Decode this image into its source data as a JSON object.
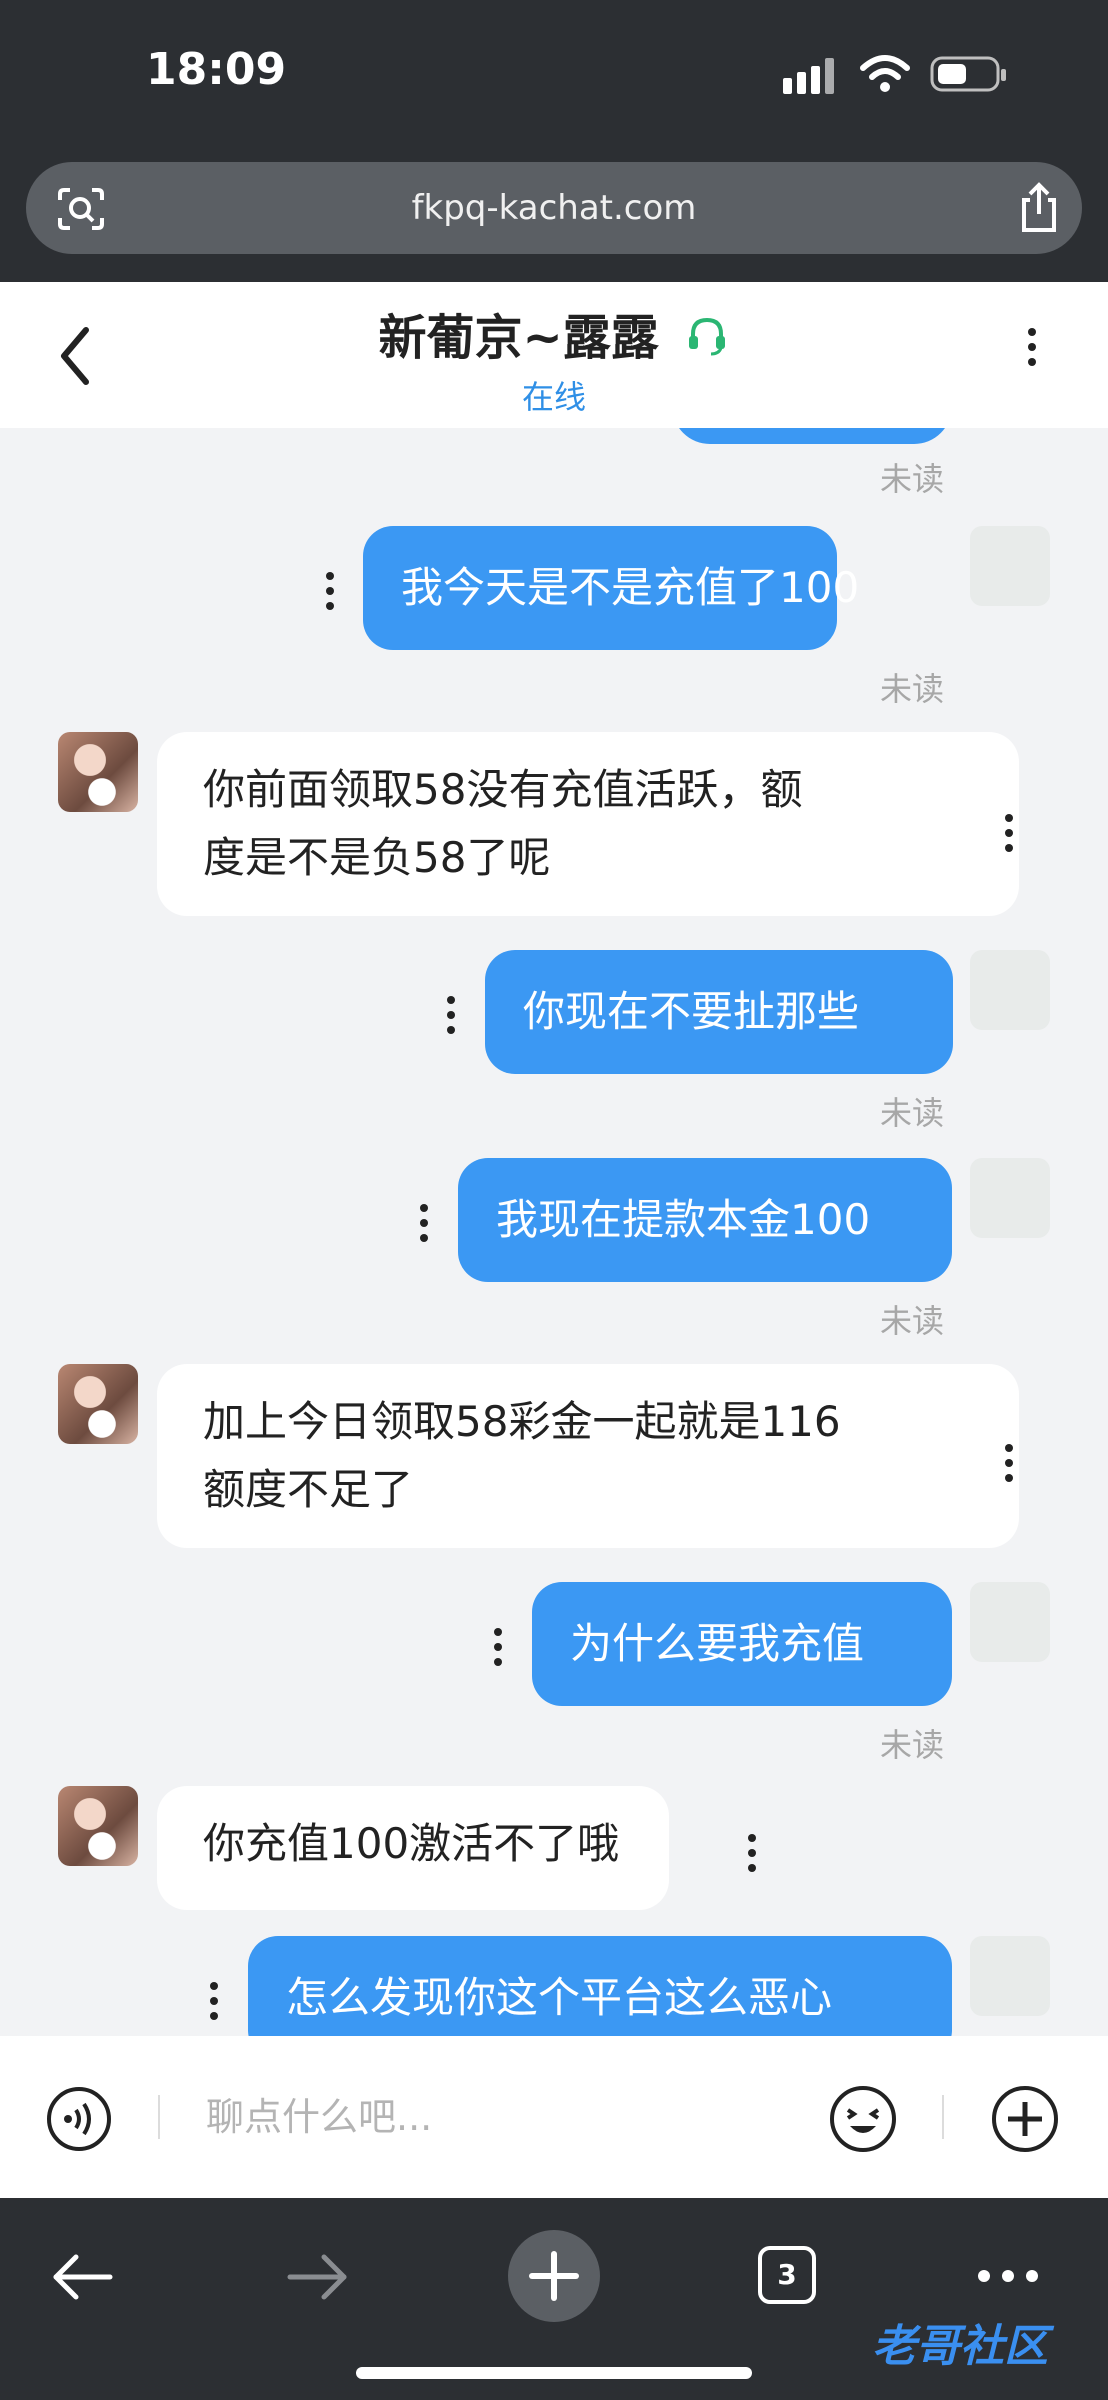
{
  "status_bar": {
    "time": "18:09"
  },
  "browser": {
    "url": "fkpq-kachat.com",
    "tab_count": "3"
  },
  "chat": {
    "title": "新葡京~露露",
    "status": "在线",
    "unread_label": "未读",
    "messages": [
      {
        "text": "我今天是不是充值了100"
      },
      {
        "line1": "你前面领取58没有充值活跃，额",
        "line2": "度是不是负58了呢"
      },
      {
        "text": "你现在不要扯那些"
      },
      {
        "text": "我现在提款本金100"
      },
      {
        "line1": "加上今日领取58彩金一起就是116",
        "line2": "额度不足了"
      },
      {
        "text": "为什么要我充值"
      },
      {
        "text": "你充值100激活不了哦"
      },
      {
        "text": "怎么发现你这个平台这么恶心"
      }
    ]
  },
  "input": {
    "placeholder": "聊点什么吧..."
  },
  "watermark": {
    "text": "老哥社区"
  },
  "colors": {
    "accent": "#3b98f3",
    "headset": "#2bb673",
    "browser_bg": "#2c2f33"
  }
}
